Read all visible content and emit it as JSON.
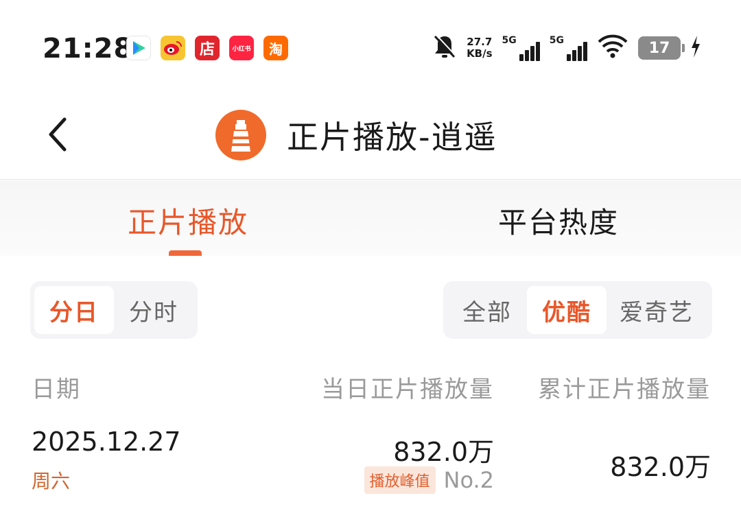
{
  "status_bar": {
    "time": "21:28",
    "app_icons": [
      {
        "name": "video-app-icon",
        "text": ""
      },
      {
        "name": "weibo-icon",
        "text": ""
      },
      {
        "name": "shop-app-icon",
        "text": "店"
      },
      {
        "name": "xiaohongshu-icon",
        "text": "小红书"
      },
      {
        "name": "taobao-icon",
        "text": "淘"
      }
    ],
    "net_speed_value": "27.7",
    "net_speed_unit": "KB/s",
    "signal1_label": "5G",
    "signal2_label": "5G",
    "battery": "17"
  },
  "header": {
    "title": "正片播放-逍遥"
  },
  "tabs": [
    {
      "label": "正片播放",
      "active": true
    },
    {
      "label": "平台热度",
      "active": false
    }
  ],
  "granularity": {
    "options": [
      "分日",
      "分时"
    ],
    "selected": "分日"
  },
  "platform": {
    "options": [
      "全部",
      "优酷",
      "爱奇艺"
    ],
    "selected": "优酷"
  },
  "table": {
    "headers": [
      "日期",
      "当日正片播放量",
      "累计正片播放量"
    ],
    "rows": [
      {
        "date": "2025.12.27",
        "weekday": "周六",
        "daily": "832.0万",
        "badge": "播放峰值",
        "rank": "No.2",
        "total": "832.0万"
      }
    ]
  },
  "colors": {
    "accent": "#e8572a",
    "muted": "#9a9a9a",
    "badge_bg": "#fbe6dc"
  }
}
